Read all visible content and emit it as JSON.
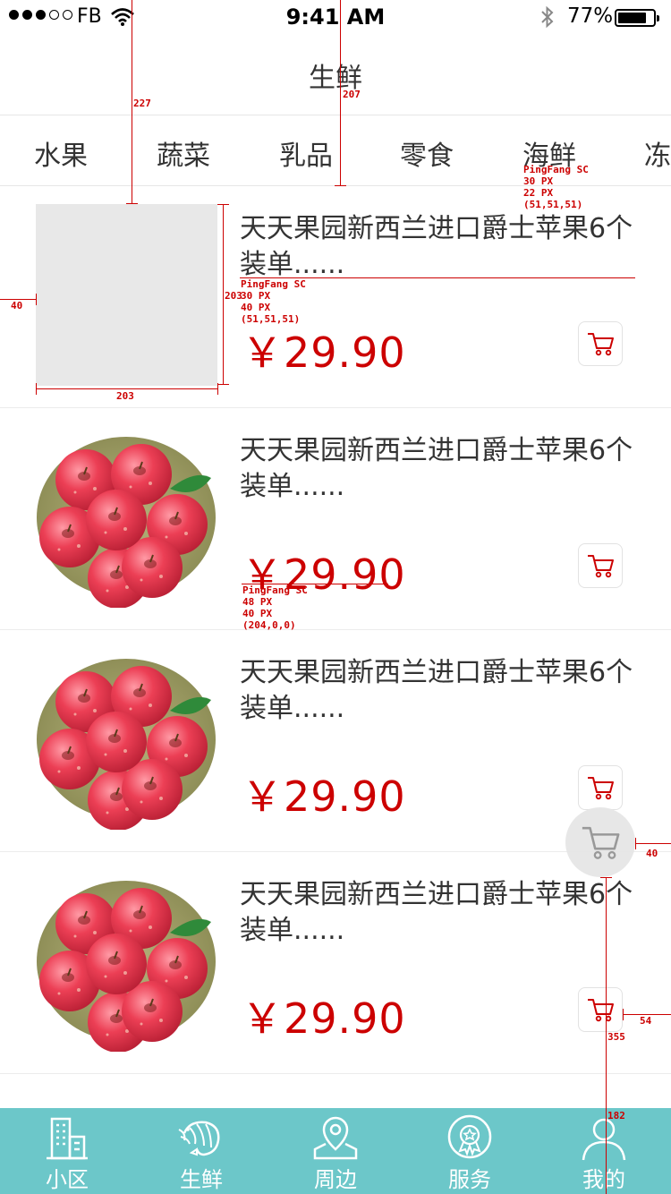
{
  "status_bar": {
    "carrier": "FB",
    "time": "9:41 AM",
    "battery": "77%"
  },
  "nav": {
    "title": "生鲜"
  },
  "categories": [
    "水果",
    "蔬菜",
    "乳品",
    "零食",
    "海鲜",
    "冻"
  ],
  "products": [
    {
      "name": "天天果园新西兰进口爵士苹果6个装单......",
      "price": "￥29.90",
      "image": "placeholder"
    },
    {
      "name": "天天果园新西兰进口爵士苹果6个装单......",
      "price": "￥29.90",
      "image": "apples"
    },
    {
      "name": "天天果园新西兰进口爵士苹果6个装单......",
      "price": "￥29.90",
      "image": "apples"
    },
    {
      "name": "天天果园新西兰进口爵士苹果6个装单......",
      "price": "￥29.90",
      "image": "apples"
    }
  ],
  "tab_bar": {
    "items": [
      {
        "label": "小区",
        "icon": "building-icon"
      },
      {
        "label": "生鲜",
        "icon": "shrimp-icon"
      },
      {
        "label": "周边",
        "icon": "map-pin-icon"
      },
      {
        "label": "服务",
        "icon": "service-badge-icon"
      },
      {
        "label": "我的",
        "icon": "user-icon"
      }
    ]
  },
  "colors": {
    "tab_bar_bg": "#6cc7c9",
    "price": "#cc0000",
    "text": "#333333",
    "annotation": "#cc0000"
  },
  "annotations": {
    "a227": "227",
    "a207": "207",
    "tab_font": "PingFang SC\n30 PX\n22 PX\n(51,51,51)",
    "a40_left": "40",
    "a203_h": "203",
    "a203_w": "203",
    "name_font": "PingFang SC\n30 PX\n40 PX\n(51,51,51)",
    "price_font": "PingFang SC\n48 PX\n40 PX\n(204,0,0)",
    "a40_right": "40",
    "a54": "54",
    "a355": "355",
    "a182": "182"
  }
}
